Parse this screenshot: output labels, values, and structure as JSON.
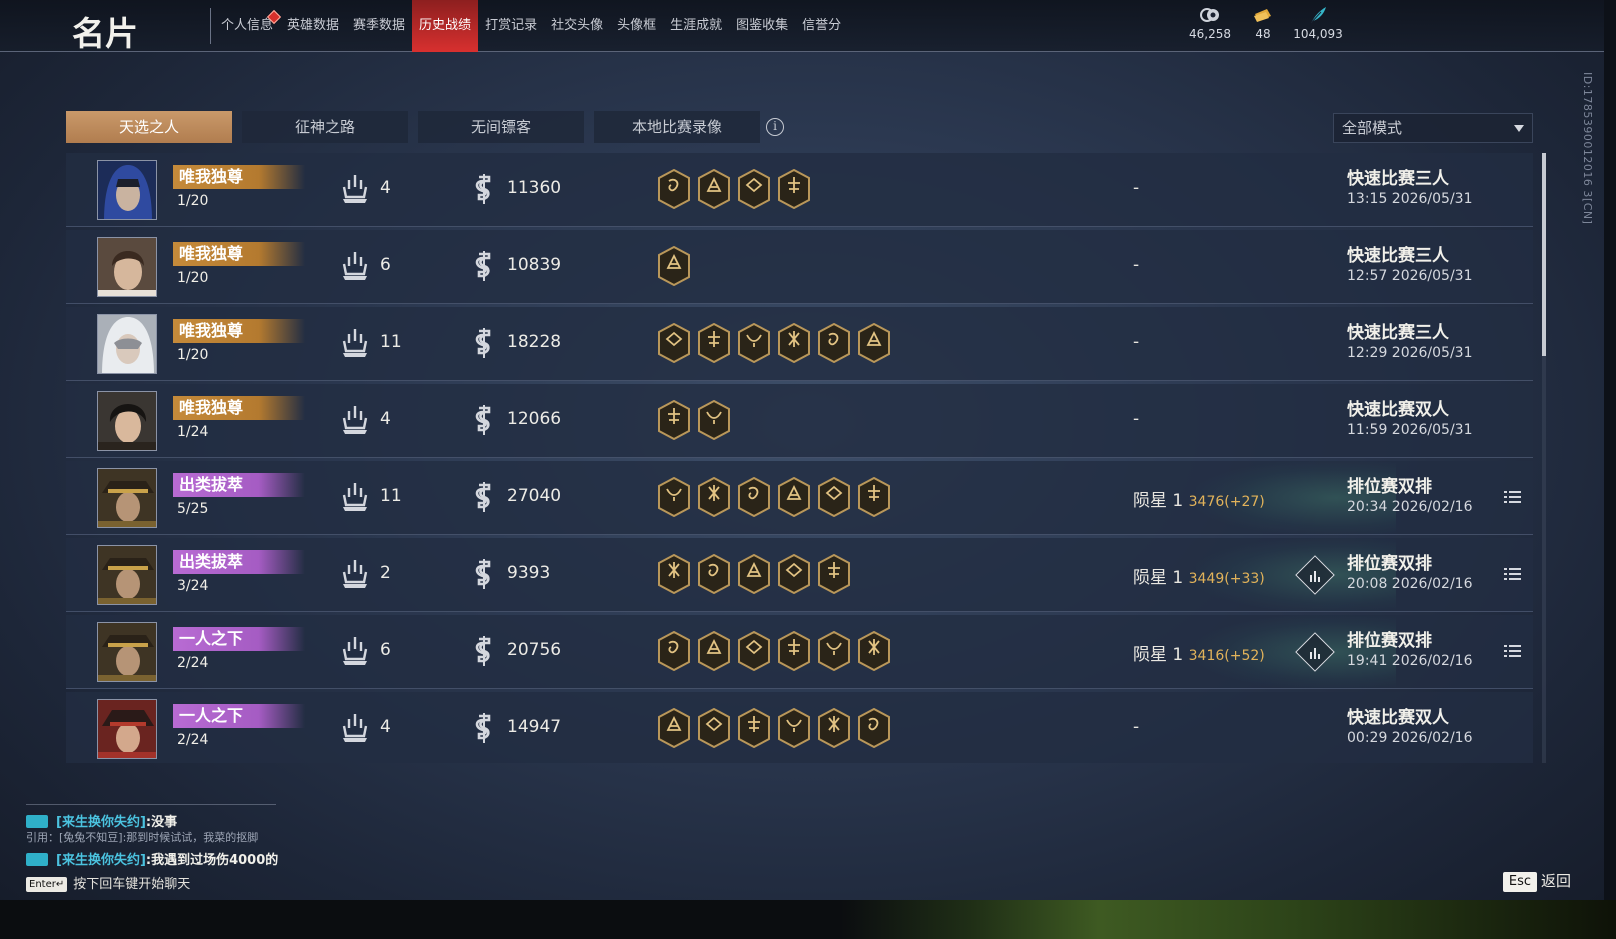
{
  "window": {
    "id_watermark": "ID:1785390012016 3[CN]"
  },
  "header": {
    "title": "名片",
    "nav": [
      {
        "label": "个人信息",
        "active": false,
        "dot": true
      },
      {
        "label": "英雄数据",
        "active": false
      },
      {
        "label": "赛季数据",
        "active": false
      },
      {
        "label": "历史战绩",
        "active": true
      },
      {
        "label": "打赏记录",
        "active": false
      },
      {
        "label": "社交头像",
        "active": false
      },
      {
        "label": "头像框",
        "active": false
      },
      {
        "label": "生涯成就",
        "active": false
      },
      {
        "label": "图鉴收集",
        "active": false
      },
      {
        "label": "信誉分",
        "active": false
      }
    ],
    "currencies": [
      {
        "icon": "coin-stack-icon",
        "value": "46,258"
      },
      {
        "icon": "ticket-icon",
        "value": "48"
      },
      {
        "icon": "feather-icon",
        "value": "104,093"
      }
    ]
  },
  "tabs": [
    {
      "label": "天选之人",
      "active": true
    },
    {
      "label": "征神之路",
      "active": false
    },
    {
      "label": "无间镖客",
      "active": false
    },
    {
      "label": "本地比赛录像",
      "active": false
    }
  ],
  "mode_filter": {
    "selected": "全部模式"
  },
  "colors": {
    "nav_active": "#d8302f",
    "tab_active": "#c9996a",
    "rank_gold": "#c58a3a",
    "rank_purple": "#b86bd3",
    "delta": "#e2b35a",
    "chat_name": "#4bc3e0"
  },
  "matches": [
    {
      "avatar": "hooded-blue",
      "rank_title": "唯我独尊",
      "rank_color": "gold",
      "placement": "1/20",
      "kills": "4",
      "damage": "11360",
      "badges": 4,
      "score": "-",
      "score_delta": "",
      "mode": "快速比赛三人",
      "time": "13:15  2026/05/31",
      "ranked": false
    },
    {
      "avatar": "brown-hair",
      "rank_title": "唯我独尊",
      "rank_color": "gold",
      "placement": "1/20",
      "kills": "6",
      "damage": "10839",
      "badges": 1,
      "score": "-",
      "score_delta": "",
      "mode": "快速比赛三人",
      "time": "12:57  2026/05/31",
      "ranked": false
    },
    {
      "avatar": "masked-white",
      "rank_title": "唯我独尊",
      "rank_color": "gold",
      "placement": "1/20",
      "kills": "11",
      "damage": "18228",
      "badges": 6,
      "score": "-",
      "score_delta": "",
      "mode": "快速比赛三人",
      "time": "12:29  2026/05/31",
      "ranked": false
    },
    {
      "avatar": "dark-hair",
      "rank_title": "唯我独尊",
      "rank_color": "gold",
      "placement": "1/24",
      "kills": "4",
      "damage": "12066",
      "badges": 2,
      "score": "-",
      "score_delta": "",
      "mode": "快速比赛双人",
      "time": "11:59  2026/05/31",
      "ranked": false
    },
    {
      "avatar": "hat-gold",
      "rank_title": "出类拔萃",
      "rank_color": "purple",
      "placement": "5/25",
      "kills": "11",
      "damage": "27040",
      "badges": 6,
      "score": "陨星 1",
      "score_delta": "3476(+27)",
      "mode": "排位赛双排",
      "time": "20:34  2026/02/16",
      "ranked": true,
      "stats": false
    },
    {
      "avatar": "hat-gold",
      "rank_title": "出类拔萃",
      "rank_color": "purple",
      "placement": "3/24",
      "kills": "2",
      "damage": "9393",
      "badges": 5,
      "score": "陨星 1",
      "score_delta": "3449(+33)",
      "mode": "排位赛双排",
      "time": "20:08  2026/02/16",
      "ranked": true,
      "stats": true
    },
    {
      "avatar": "hat-gold",
      "rank_title": "一人之下",
      "rank_color": "purple",
      "placement": "2/24",
      "kills": "6",
      "damage": "20756",
      "badges": 6,
      "score": "陨星 1",
      "score_delta": "3416(+52)",
      "mode": "排位赛双排",
      "time": "19:41  2026/02/16",
      "ranked": true,
      "stats": true
    },
    {
      "avatar": "red-hat",
      "rank_title": "一人之下",
      "rank_color": "purple",
      "placement": "2/24",
      "kills": "4",
      "damage": "14947",
      "badges": 6,
      "score": "-",
      "score_delta": "",
      "mode": "快速比赛双人",
      "time": "00:29  2026/02/16",
      "ranked": false
    }
  ],
  "chat": {
    "messages": [
      {
        "name": "[来生换你失约]",
        "text": ":没事"
      },
      {
        "quote": "引用：[兔兔不知豆]:那到时候试试，我菜的抠脚"
      },
      {
        "name": "[来生换你失约]",
        "text": ":我遇到过场伤4000的"
      }
    ],
    "enter_key": "Enter↵",
    "hint": "按下回车键开始聊天"
  },
  "footer": {
    "esc_key": "Esc",
    "back_label": "返回"
  }
}
